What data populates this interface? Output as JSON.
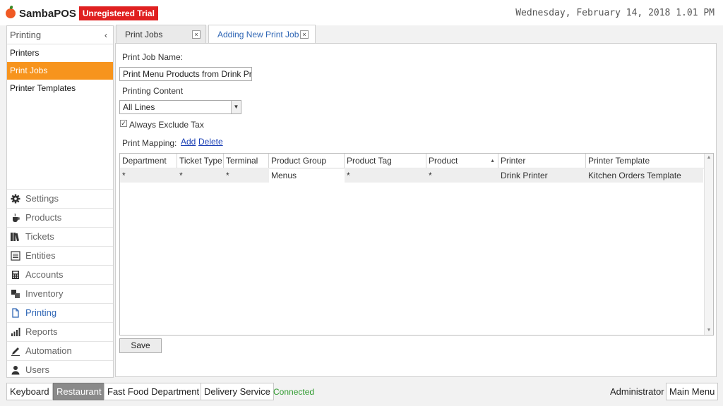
{
  "app": {
    "logo_text": "SambaPOS",
    "trial_badge": "Unregistered Trial",
    "datetime": "Wednesday, February 14, 2018 1.01 PM"
  },
  "leftpanel": {
    "header": "Printing",
    "collapse_icon": "‹",
    "items": [
      {
        "label": "Printers"
      },
      {
        "label": "Print Jobs"
      },
      {
        "label": "Printer Templates"
      }
    ],
    "modules": [
      {
        "label": "Settings",
        "icon": "gear-icon"
      },
      {
        "label": "Products",
        "icon": "coffee-cup-icon"
      },
      {
        "label": "Tickets",
        "icon": "books-icon"
      },
      {
        "label": "Entities",
        "icon": "list-icon"
      },
      {
        "label": "Accounts",
        "icon": "calculator-icon"
      },
      {
        "label": "Inventory",
        "icon": "inventory-icon"
      },
      {
        "label": "Printing",
        "icon": "document-icon"
      },
      {
        "label": "Reports",
        "icon": "bar-chart-icon"
      },
      {
        "label": "Automation",
        "icon": "pen-icon"
      },
      {
        "label": "Users",
        "icon": "user-icon"
      }
    ]
  },
  "tabs": [
    {
      "label": "Print Jobs",
      "close": "×"
    },
    {
      "label": "Adding New Print Job",
      "close": "×"
    }
  ],
  "form": {
    "name_label": "Print Job Name:",
    "name_value": "Print Menu Products from Drink Pr",
    "content_label": "Printing Content",
    "content_value": "All Lines",
    "exclude_tax_checked": true,
    "exclude_tax_label": "Always Exclude Tax",
    "mapping_label": "Print Mapping:",
    "add_link": "Add",
    "delete_link": "Delete"
  },
  "grid": {
    "columns": [
      "Department",
      "Ticket Type",
      "Terminal",
      "Product Group",
      "Product Tag",
      "Product",
      "Printer",
      "Printer Template"
    ],
    "rows": [
      [
        "*",
        "*",
        "*",
        "Menus",
        "*",
        "*",
        "Drink Printer",
        "Kitchen Orders Template"
      ]
    ]
  },
  "save_label": "Save",
  "bottombar": {
    "keyboard": "Keyboard",
    "restaurant": "Restaurant",
    "fast_food": "Fast Food Department",
    "delivery": "Delivery Service",
    "status": "Connected",
    "user": "Administrator",
    "main_menu": "Main Menu"
  },
  "colors": {
    "accent_orange": "#f7941d",
    "trial_red": "#e02020",
    "active_blue": "#2f66b5",
    "connected_green": "#2e9a2e"
  }
}
